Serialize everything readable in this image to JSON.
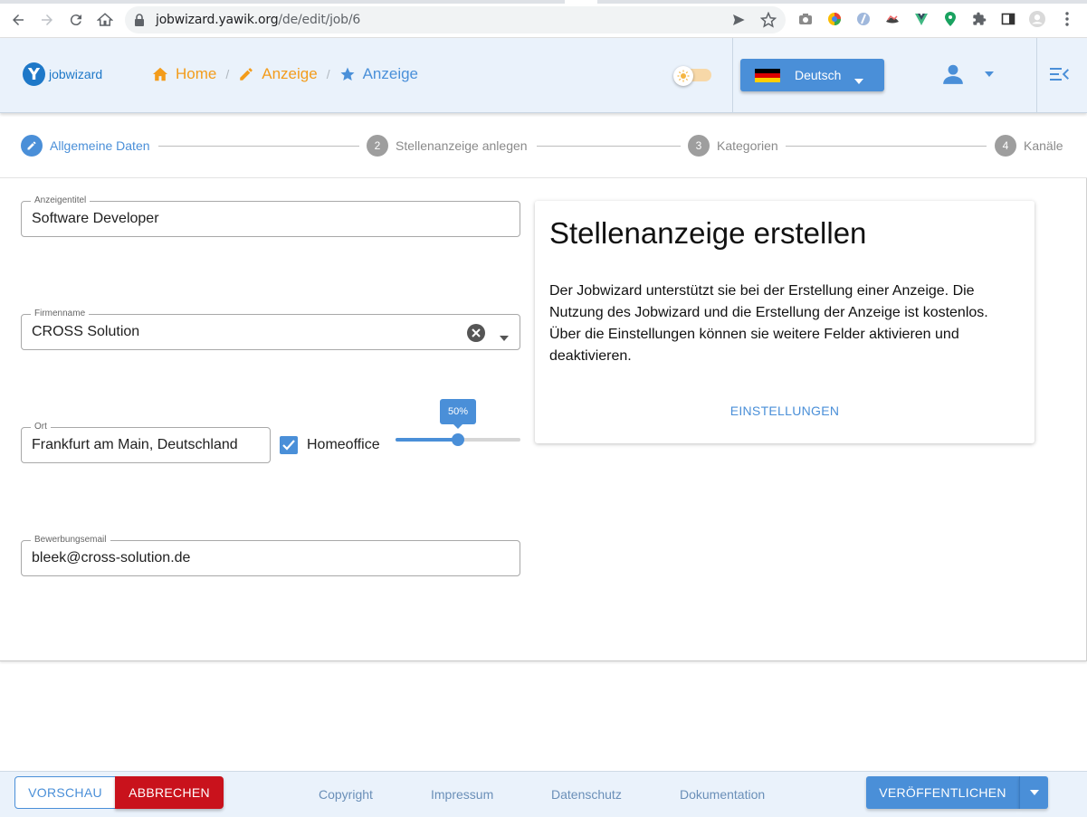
{
  "browser": {
    "url_host": "jobwizard.yawik.org",
    "url_path": "/de/edit/job/6",
    "icons": [
      "back-icon",
      "forward-icon",
      "reload-icon",
      "home-icon",
      "lock-icon",
      "send-icon",
      "bookmark-star-icon",
      "camera-icon",
      "extension-icons",
      "puzzle-icon",
      "sidebar-icon",
      "profile-icon",
      "more-vert-icon"
    ]
  },
  "header": {
    "logo_text": "jobwizard",
    "breadcrumbs": [
      {
        "label": "Home",
        "icon": "home-icon",
        "color": "#f39c1b"
      },
      {
        "label": "Anzeige",
        "icon": "pencil-icon",
        "color": "#f39c1b"
      },
      {
        "label": "Anzeige",
        "icon": "star-icon",
        "color": "#4a90d9"
      }
    ],
    "language": "Deutsch",
    "accent_color": "#4a8fd8"
  },
  "stepper": {
    "steps": [
      {
        "number": "1",
        "label": "Allgemeine Daten",
        "state": "active"
      },
      {
        "number": "2",
        "label": "Stellenanzeige anlegen",
        "state": "inactive"
      },
      {
        "number": "3",
        "label": "Kategorien",
        "state": "inactive"
      },
      {
        "number": "4",
        "label": "Kanäle",
        "state": "inactive"
      }
    ]
  },
  "form": {
    "title": {
      "label": "Anzeigentitel",
      "value": "Software Developer"
    },
    "company": {
      "label": "Firmenname",
      "value": "CROSS Solution"
    },
    "location": {
      "label": "Ort",
      "value": "Frankfurt am Main, Deutschland"
    },
    "homeoffice": {
      "label": "Homeoffice",
      "checked": true,
      "percent": 50,
      "percent_label": "50%"
    },
    "email": {
      "label": "Bewerbungsemail",
      "value": "bleek@cross-solution.de"
    }
  },
  "info_card": {
    "title": "Stellenanzeige erstellen",
    "text": "Der Jobwizard unterstützt sie bei der Erstellung einer Anzeige. Die Nutzung des Jobwizard und die Erstellung der Anzeige ist kostenlos. Über die Einstellungen können sie weitere Felder aktivieren und deaktivieren.",
    "button": "EINSTELLUNGEN"
  },
  "footer": {
    "preview": "VORSCHAU",
    "cancel": "ABBRECHEN",
    "links": [
      "Copyright",
      "Impressum",
      "Datenschutz",
      "Dokumentation"
    ],
    "publish": "VERÖFFENTLICHEN",
    "cancel_color": "#c9121c"
  }
}
